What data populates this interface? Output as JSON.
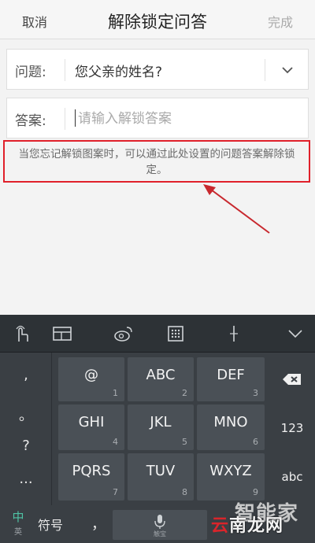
{
  "header": {
    "cancel": "取消",
    "title": "解除锁定问答",
    "done": "完成"
  },
  "form": {
    "question_label": "问题:",
    "question_value": "您父亲的姓名?",
    "answer_label": "答案:",
    "answer_placeholder": "请输入解锁答案",
    "answer_value": ""
  },
  "hint": "当您忘记解锁图案时，可以通过此处设置的问题答案解除锁定。",
  "colors": {
    "annotation_red": "#e0202a",
    "header_bg": "#f6f6f6",
    "keyboard_bg": "#3a3f44",
    "key_bg": "#4a5056"
  },
  "keyboard": {
    "toolbar_icons": [
      "gesture-icon",
      "layout-icon",
      "weibo-icon",
      "numpad-icon",
      "cursor-icon",
      "collapse-icon"
    ],
    "side_symbols": [
      ",",
      "。",
      "?",
      "..."
    ],
    "keys": [
      {
        "letters": "@",
        "num": "1"
      },
      {
        "letters": "ABC",
        "num": "2"
      },
      {
        "letters": "DEF",
        "num": "3"
      },
      {
        "letters": "GHI",
        "num": "4"
      },
      {
        "letters": "JKL",
        "num": "5"
      },
      {
        "letters": "MNO",
        "num": "6"
      },
      {
        "letters": "PQRS",
        "num": "7"
      },
      {
        "letters": "TUV",
        "num": "8"
      },
      {
        "letters": "WXYZ",
        "num": "9"
      }
    ],
    "num_key": "123",
    "abc_key": "abc",
    "lang_zh": "中",
    "lang_en": "英",
    "symbols": "符号",
    "comma": "，",
    "space_brand": "触宝"
  },
  "watermark": {
    "line1": "智能家",
    "line2_a": "云",
    "line2_b": "南龙网"
  }
}
